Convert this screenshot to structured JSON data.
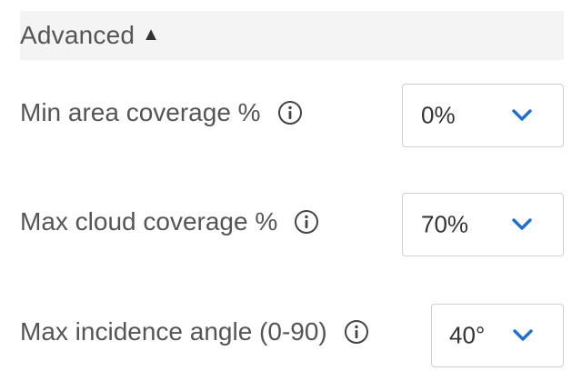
{
  "advanced": {
    "title": "Advanced",
    "caret": "▲"
  },
  "fields": [
    {
      "label": "Min area coverage %",
      "value": "0%",
      "icon": "info-icon"
    },
    {
      "label": "Max cloud coverage %",
      "value": "70%",
      "icon": "info-icon"
    },
    {
      "label": "Max incidence angle (0-90)",
      "value": "40°",
      "icon": "info-icon"
    }
  ],
  "colors": {
    "header_bg": "#f4f4f4",
    "label_text": "#555555",
    "value_text": "#333333",
    "chevron": "#1f6fd1",
    "border": "#cfcfcf"
  }
}
